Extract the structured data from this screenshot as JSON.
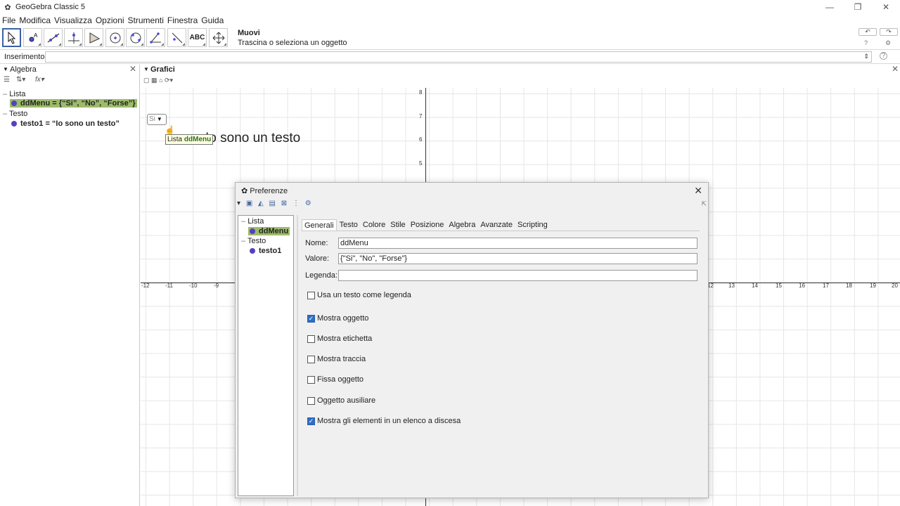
{
  "window": {
    "title": "GeoGebra Classic 5",
    "minimize_glyph": "—",
    "restore_glyph": "❐",
    "close_glyph": "✕"
  },
  "menu": [
    "File",
    "Modifica",
    "Visualizza",
    "Opzioni",
    "Strumenti",
    "Finestra",
    "Guida"
  ],
  "toolbar": {
    "active_tool_name": "Muovi",
    "active_tool_help": "Trascina o seleziona un oggetto",
    "tools": [
      "move-tool-icon",
      "point-tool-icon",
      "line-tool-icon",
      "perpendicular-tool-icon",
      "polygon-tool-icon",
      "circle-tool-icon",
      "conic-tool-icon",
      "angle-tool-icon",
      "reflect-tool-icon",
      "text-tool-icon",
      "move-graphics-view-icon"
    ],
    "text_tool_label": "ABC"
  },
  "inputbar": {
    "label": "Inserimento:",
    "value": ""
  },
  "algebra": {
    "title": "Algebra",
    "groups": [
      {
        "name": "Lista",
        "items": [
          {
            "text": "ddMenu = {“Si”, “No”, “Forse”}",
            "selected": true
          }
        ]
      },
      {
        "name": "Testo",
        "items": [
          {
            "text": "testo1 = “Io sono un testo”",
            "selected": false
          }
        ]
      }
    ]
  },
  "graphics": {
    "title": "Grafici",
    "dropdown_value": "Si",
    "text_object": "Io sono un testo",
    "tooltip_prefix": "Lista",
    "tooltip_name": "ddMenu",
    "x_ticks": [
      "-12",
      "-11",
      "-10",
      "-9",
      "12",
      "13",
      "14",
      "15",
      "16",
      "17",
      "18",
      "19",
      "20"
    ],
    "y_ticks": [
      "8",
      "7",
      "6",
      "5"
    ]
  },
  "dialog": {
    "title": "Preferenze",
    "tree": [
      {
        "name": "Lista",
        "items": [
          {
            "text": "ddMenu",
            "selected": true
          }
        ]
      },
      {
        "name": "Testo",
        "items": [
          {
            "text": "testo1",
            "selected": false
          }
        ]
      }
    ],
    "tabs": [
      "Generali",
      "Testo",
      "Colore",
      "Stile",
      "Posizione",
      "Algebra",
      "Avanzate",
      "Scripting"
    ],
    "active_tab": "Generali",
    "fields": {
      "name_label": "Nome:",
      "name_value": "ddMenu",
      "value_label": "Valore:",
      "value_value": "{\"Si\", \"No\", \"Forse\"}",
      "caption_label": "Legenda:",
      "caption_value": ""
    },
    "checkboxes": [
      {
        "label": "Usa un testo come legenda",
        "checked": false
      },
      {
        "label": "Mostra oggetto",
        "checked": true
      },
      {
        "label": "Mostra etichetta",
        "checked": false
      },
      {
        "label": "Mostra traccia",
        "checked": false
      },
      {
        "label": "Fissa oggetto",
        "checked": false
      },
      {
        "label": "Oggetto ausiliare",
        "checked": false
      },
      {
        "label": "Mostra gli elementi in un elenco a discesa",
        "checked": true
      }
    ]
  }
}
